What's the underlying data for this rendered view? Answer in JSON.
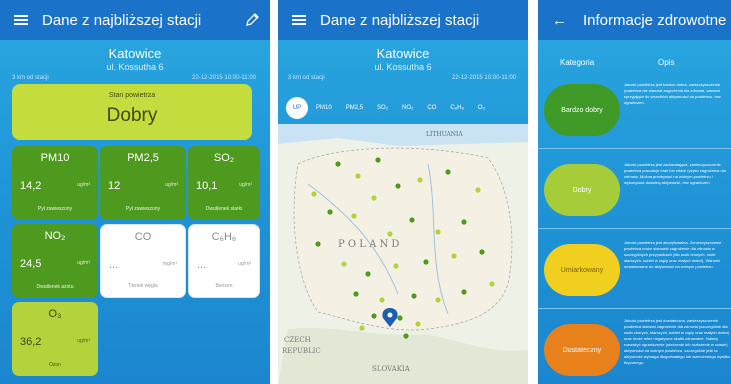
{
  "screen1": {
    "title": "Dane z najbliższej stacji",
    "city": "Katowice",
    "street": "ul. Kossutha 6",
    "distance": "3 km od stacji",
    "datetime": "22-12-2015 10:00-11:00",
    "status_label": "Stan powietrza",
    "status_value": "Dobry",
    "tiles": [
      {
        "name": "PM10",
        "value": "14,2",
        "unit": "ug/m³",
        "desc": "Pył zawieszony"
      },
      {
        "name": "PM2,5",
        "value": "12",
        "unit": "ug/m³",
        "desc": "Pył zawieszony"
      },
      {
        "name": "SO₂",
        "value": "10,1",
        "unit": "ug/m³",
        "desc": "Dwutlenek siarki"
      },
      {
        "name": "NO₂",
        "value": "24,5",
        "unit": "ug/m³",
        "desc": "Dwutlenek azotu"
      },
      {
        "name": "CO",
        "value": "...",
        "unit": "mg/m³",
        "desc": "Tlenek węgla"
      },
      {
        "name": "C₆H₆",
        "value": "...",
        "unit": "ug/m³",
        "desc": "Benzen"
      },
      {
        "name": "O₃",
        "value": "36,2",
        "unit": "ug/m³",
        "desc": "Ozon"
      }
    ]
  },
  "screen2": {
    "title": "Dane z najbliższej stacji",
    "city": "Katowice",
    "street": "ul. Kossutha 6",
    "distance": "3 km od stacji",
    "datetime": "22-12-2015 10:00-11:00",
    "tabs": [
      "UP",
      "PM10",
      "PM2,5",
      "SO₂",
      "NO₂",
      "CO",
      "C₆H₆",
      "O₃"
    ],
    "map_labels": {
      "country": "P O L A N D",
      "lithuania": "LITHUANIA",
      "czech": "CZECH",
      "republic": "REPUBLIC",
      "slovakia": "SLOVAKIA"
    }
  },
  "screen3": {
    "title": "Informacje zdrowotne",
    "col_category": "Kategoria",
    "col_desc": "Opis",
    "categories": [
      {
        "name": "Bardzo dobry",
        "color": "#3f9a28",
        "desc": "Jakość powietrza jest bardzo dobra, zanieczyszczenie powietrza nie stanowi zagrożenia dla zdrowia, warunki sprzyjające do wszelkich aktywności na powietrzu, bez ograniczeń."
      },
      {
        "name": "Dobry",
        "color": "#a7cc3a",
        "desc": "Jakość powietrza jest zadowalająca, zanieczyszczenie powietrza powoduje brak lub niskie ryzyko zagrożenia dla zdrowia. Można przebywać na wolnym powietrzu i wykonywać dowolną aktywność, bez ograniczeń."
      },
      {
        "name": "Umiarkowany",
        "color": "#f0cf1f",
        "desc": "Jakość powietrza jest akceptowalna. Zanieczyszczenie powietrza może stanowić zagrożenie dla zdrowia w szczególnych przypadkach (dla osób chorych, osób starszych, kobiet w ciąży oraz małych dzieci). Warunki umiarkowane do aktywności na wolnym powietrzu."
      },
      {
        "name": "Dostateczny",
        "color": "#e8801c",
        "desc": "Jakość powietrza jest dostateczna, zanieczyszczenie powietrza stanowi zagrożenie dla zdrowia (szczególnie dla osób chorych, starszych, kobiet w ciąży oraz małych dzieci) oraz może mieć negatywne skutki zdrowotne. Należy rozważyć ograniczenie (skrócenie lub rozłożenie w czasie) aktywności na wolnym powietrzu, szczególnie jeśli ta aktywność wymaga długotrwałego lub wzmożonego wysiłku fizycznego."
      }
    ]
  },
  "colors": {
    "topbar": "#1a73c9",
    "background": "#2299db",
    "green": "#4d9a1e",
    "lime": "#b3d23c"
  }
}
